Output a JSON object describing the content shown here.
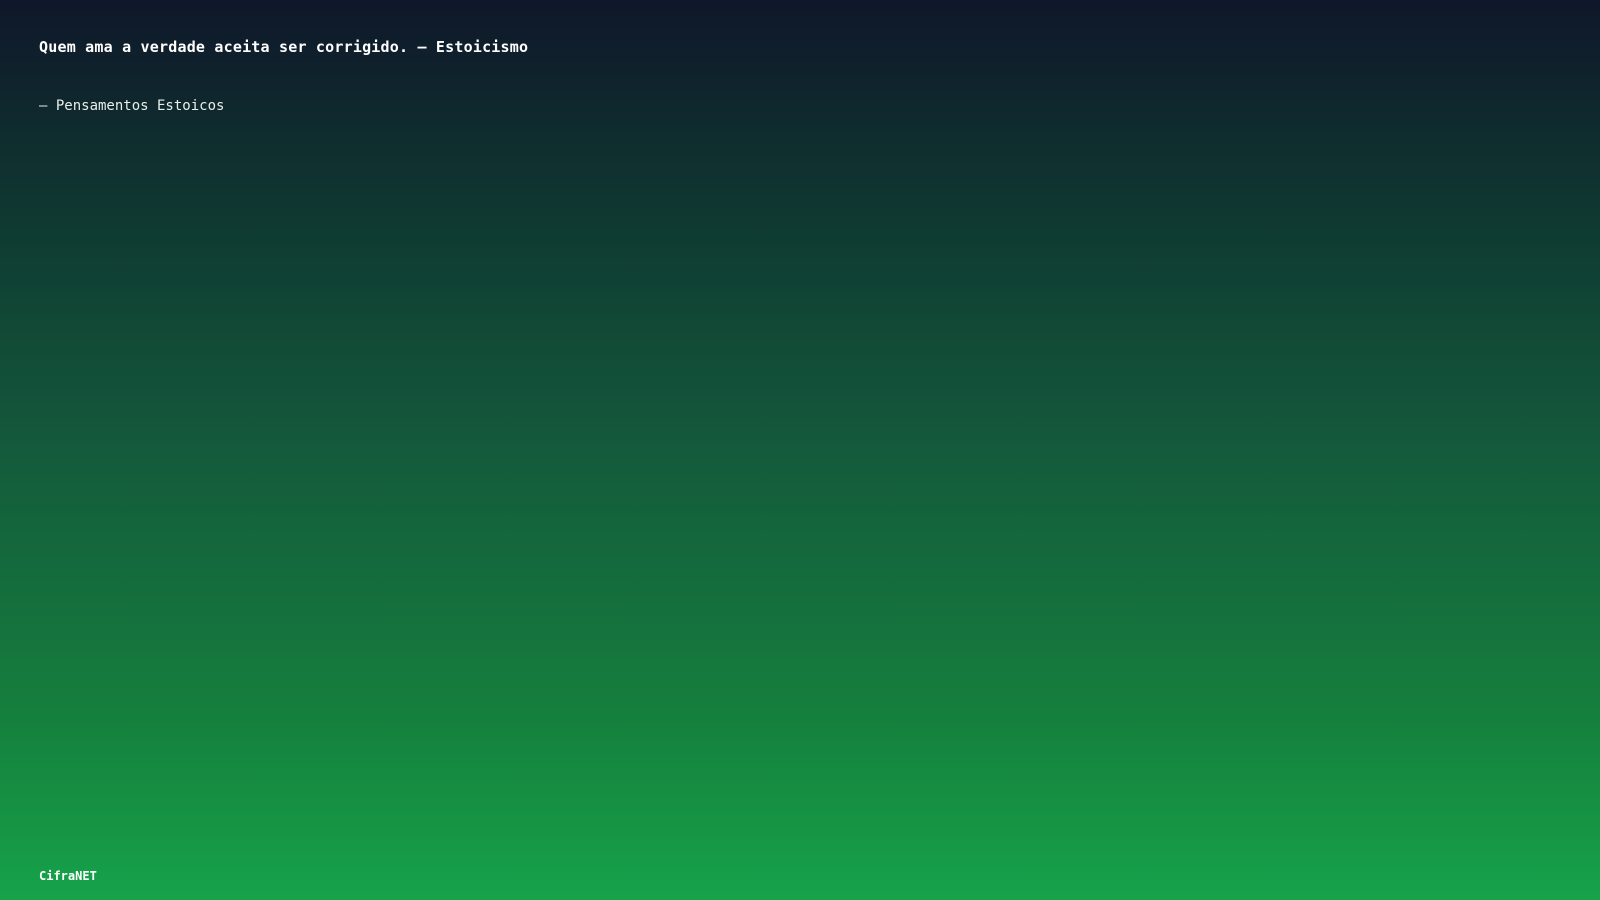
{
  "quote": {
    "text": "Quem ama a verdade aceita ser corrigido. — Estoicismo",
    "attribution": "– Pensamentos Estoicos"
  },
  "footer": {
    "brand": "CifraNET"
  },
  "colors": {
    "gradient_top": "#0f172a",
    "gradient_bottom": "#16a34a",
    "text": "#ffffff"
  }
}
